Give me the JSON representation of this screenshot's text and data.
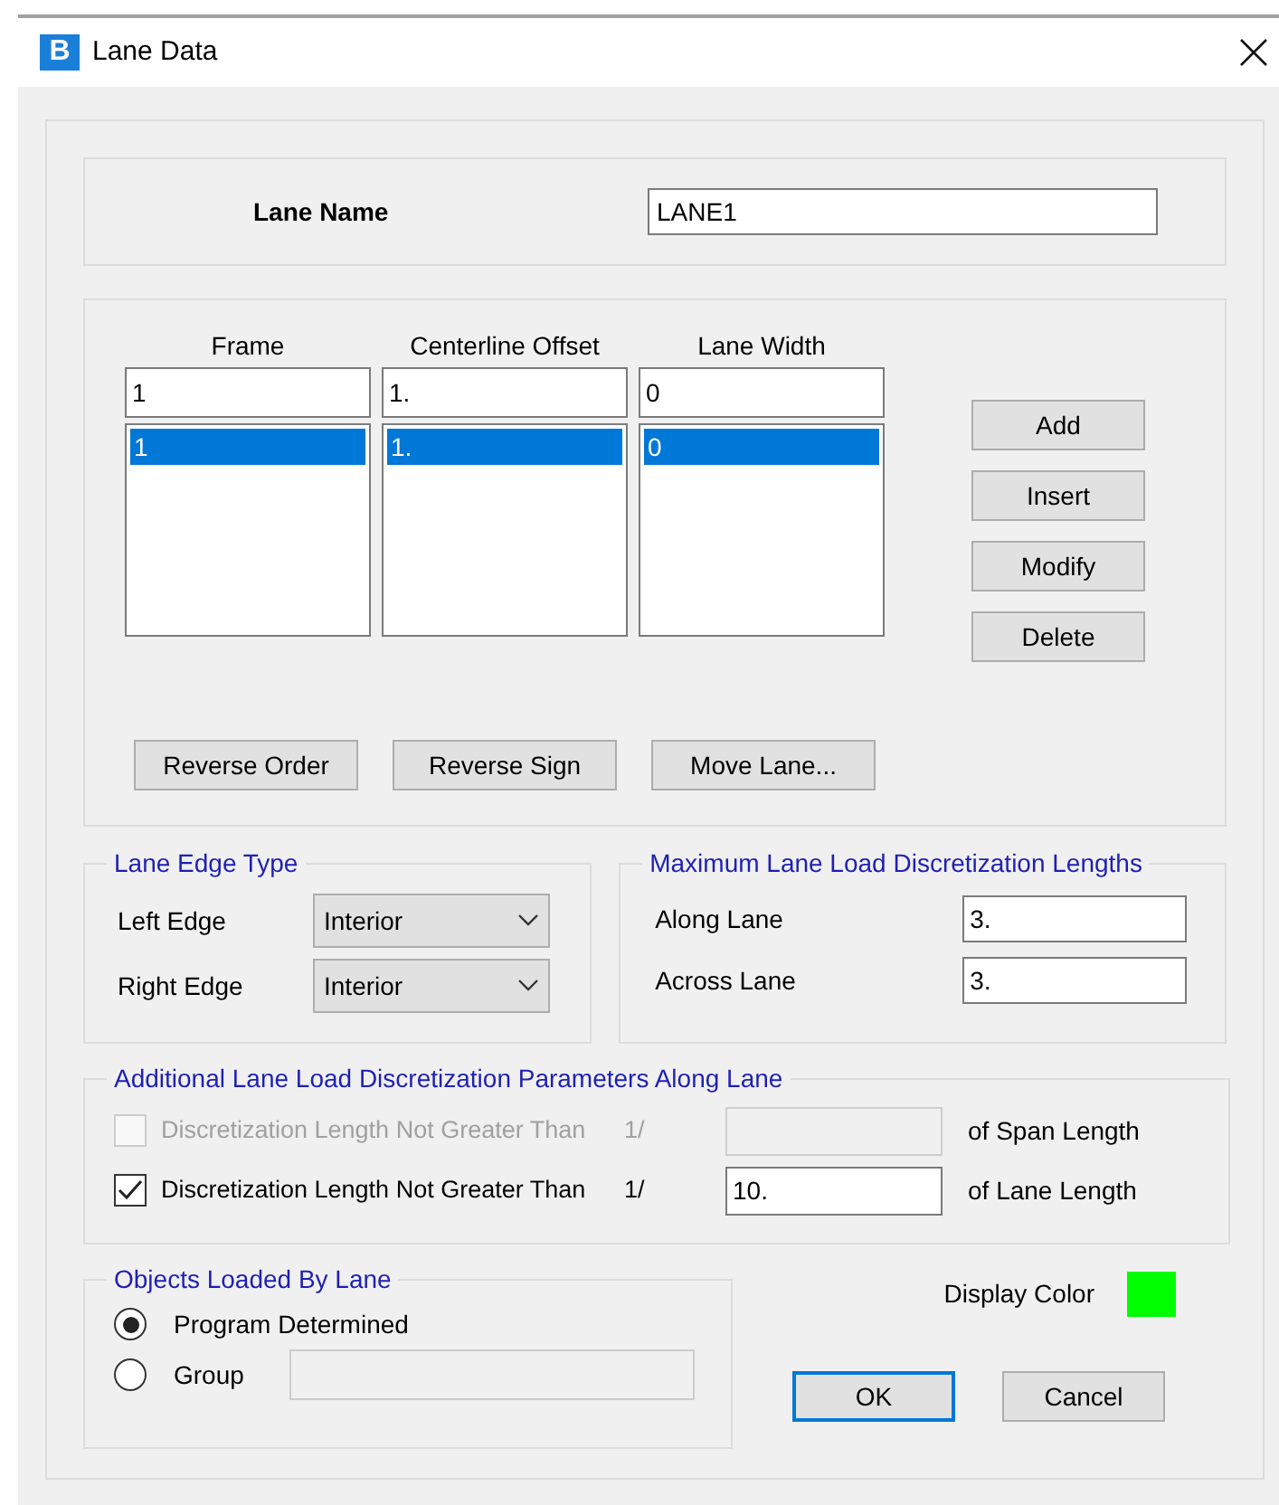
{
  "window": {
    "title": "Lane Data",
    "icon_letter": "B"
  },
  "lane_name": {
    "label": "Lane Name",
    "value": "LANE1"
  },
  "table": {
    "columns": [
      {
        "header": "Frame",
        "input_value": "1",
        "items": [
          {
            "text": "1",
            "selected": true
          }
        ]
      },
      {
        "header": "Centerline Offset",
        "input_value": "1.",
        "items": [
          {
            "text": "1.",
            "selected": true
          }
        ]
      },
      {
        "header": "Lane Width",
        "input_value": "0",
        "items": [
          {
            "text": "0",
            "selected": true
          }
        ]
      }
    ],
    "side_buttons": [
      "Add",
      "Insert",
      "Modify",
      "Delete"
    ],
    "bottom_buttons": [
      "Reverse Order",
      "Reverse Sign",
      "Move Lane..."
    ]
  },
  "lane_edge_type": {
    "title": "Lane Edge Type",
    "rows": [
      {
        "label": "Left Edge",
        "value": "Interior"
      },
      {
        "label": "Right Edge",
        "value": "Interior"
      }
    ]
  },
  "max_lengths": {
    "title": "Maximum Lane Load Discretization Lengths",
    "rows": [
      {
        "label": "Along Lane",
        "value": "3."
      },
      {
        "label": "Across Lane",
        "value": "3."
      }
    ]
  },
  "additional": {
    "title": "Additional Lane Load Discretization Parameters Along Lane",
    "rows": [
      {
        "label": "Discretization Length Not Greater Than",
        "fraction": "1/",
        "suffix": "of Span Length",
        "checked": false,
        "disabled": true
      },
      {
        "label": "Discretization Length Not Greater Than",
        "fraction": "1/",
        "value": "10.",
        "suffix": "of Lane Length",
        "checked": true,
        "disabled": false
      }
    ]
  },
  "objects": {
    "title": "Objects Loaded By Lane",
    "options": [
      {
        "label": "Program Determined",
        "selected": true,
        "kind": "plain"
      },
      {
        "label": "Group",
        "selected": false,
        "kind": "with-field"
      }
    ]
  },
  "display_color": {
    "label": "Display Color",
    "color": "#00ff00"
  },
  "dialog_buttons": [
    {
      "label": "OK",
      "default": true
    },
    {
      "label": "Cancel",
      "default": false
    }
  ]
}
